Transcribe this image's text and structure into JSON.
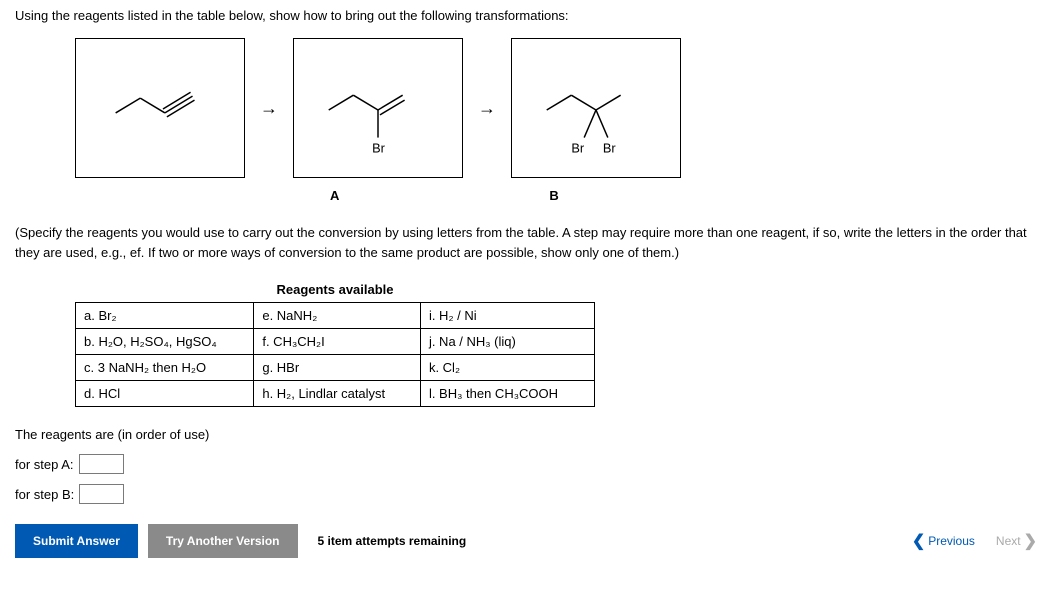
{
  "intro": "Using the reagents listed in the table below, show how to bring out the following transformations:",
  "structures": {
    "str1_label": "",
    "str2_label": "Br",
    "str3_label_left": "Br",
    "str3_label_right": "Br"
  },
  "labels": {
    "a": "A",
    "b": "B"
  },
  "note": "(Specify the reagents you would use to carry out the conversion by using letters from the table. A step may require more than one reagent, if so, write the letters in the order that they are used, e.g., ef. If two or more ways of conversion to the same product are possible, show only one of them.)",
  "table": {
    "title": "Reagents available",
    "rows": [
      {
        "c1": "a. Br₂",
        "c2": "e. NaNH₂",
        "c3": "i. H₂ / Ni"
      },
      {
        "c1": "b. H₂O, H₂SO₄, HgSO₄",
        "c2": "f. CH₃CH₂I",
        "c3": "j. Na / NH₃ (liq)"
      },
      {
        "c1": "c. 3 NaNH₂ then H₂O",
        "c2": "g. HBr",
        "c3": "k. Cl₂"
      },
      {
        "c1": "d. HCl",
        "c2": "h. H₂, Lindlar catalyst",
        "c3": "l. BH₃ then CH₃COOH"
      }
    ]
  },
  "answer": {
    "intro": "The reagents are (in order of use)",
    "step_a_label": "for step A:",
    "step_a_value": "",
    "step_b_label": "for step B:",
    "step_b_value": ""
  },
  "buttons": {
    "submit": "Submit Answer",
    "try": "Try Another Version",
    "attempts": "5 item attempts remaining",
    "previous": "Previous",
    "next": "Next"
  }
}
